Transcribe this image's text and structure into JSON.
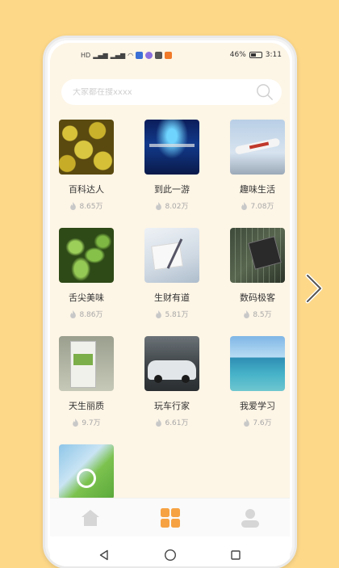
{
  "status_bar": {
    "left_icons": [
      "hd-icon",
      "signal-icon",
      "signal-icon",
      "wifi-icon",
      "app-icon",
      "app-icon",
      "app-icon",
      "app-icon"
    ],
    "battery_percent": "46%",
    "time": "3:11"
  },
  "search": {
    "placeholder": "大家都在搜xxxx",
    "value": ""
  },
  "items": [
    {
      "title": "百科达人",
      "views": "8.65万"
    },
    {
      "title": "到此一游",
      "views": "8.02万"
    },
    {
      "title": "趣味生活",
      "views": "7.08万"
    },
    {
      "title": "舌尖美味",
      "views": "8.86万"
    },
    {
      "title": "生财有道",
      "views": "5.81万"
    },
    {
      "title": "数码极客",
      "views": "8.5万"
    },
    {
      "title": "天生丽质",
      "views": "9.7万"
    },
    {
      "title": "玩车行家",
      "views": "6.61万"
    },
    {
      "title": "我爱学习",
      "views": "7.6万"
    },
    {
      "title": "",
      "views": ""
    }
  ],
  "tabbar": {
    "tabs": [
      {
        "name": "home-icon",
        "active": false
      },
      {
        "name": "grid-icon",
        "active": true
      },
      {
        "name": "user-icon",
        "active": false
      }
    ],
    "active_color": "#f6a243",
    "inactive_color": "#d6d6d6"
  },
  "system_nav": [
    "back-icon",
    "home-circle-icon",
    "recents-icon"
  ]
}
